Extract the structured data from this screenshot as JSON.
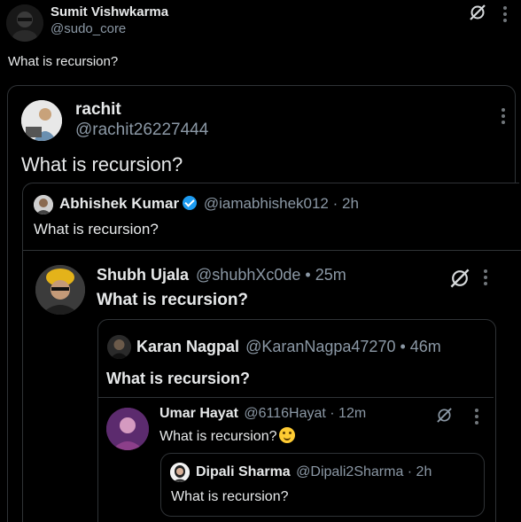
{
  "main_tweet": {
    "name": "Sumit Vishwkarma",
    "handle": "@sudo_core",
    "text": "What is recursion?"
  },
  "quote1": {
    "name": "rachit",
    "handle": "@rachit26227444",
    "text": "What is recursion?"
  },
  "quote2": {
    "name": "Abhishek Kumar",
    "handle": "@iamabhishek012 · 2h",
    "text": "What is recursion?"
  },
  "quote3": {
    "name": "Shubh Ujala",
    "handle": "@shubhXc0de • 25m",
    "text": "What is recursion?"
  },
  "quote4": {
    "name": "Karan Nagpal",
    "handle": "@KaranNagpa47270 • 46m",
    "text": "What is recursion?"
  },
  "quote5": {
    "name": "Umar Hayat",
    "handle": "@6116Hayat · 12m",
    "text": "What is recursion?"
  },
  "quote6": {
    "name": "Dipali Sharma",
    "handle": "@Dipali2Sharma · 2h",
    "text": "What is recursion?"
  }
}
